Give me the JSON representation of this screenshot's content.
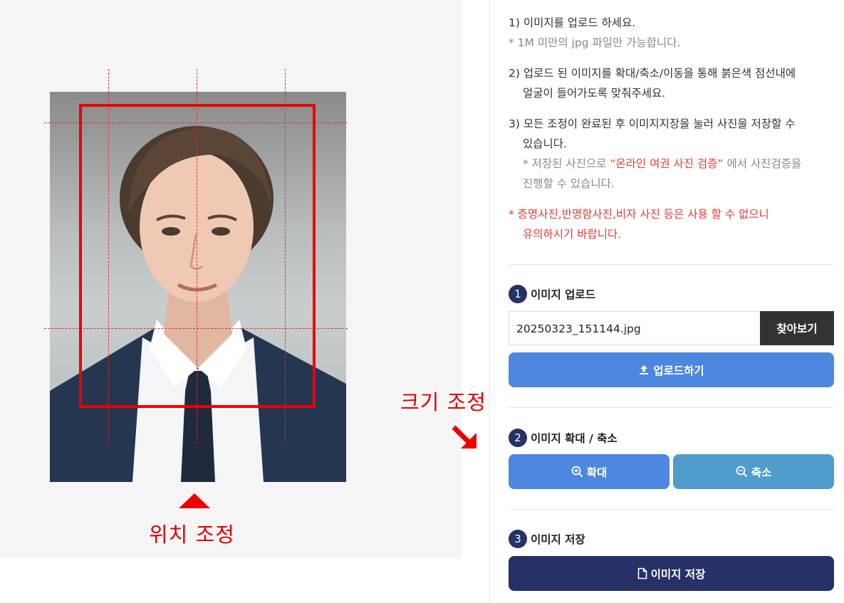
{
  "editor": {
    "position_label": "위치 조정",
    "size_label": "크기 조정"
  },
  "instructions": {
    "step1": "1) 이미지를 업로드 하세요.",
    "step1_note": "* 1M 미만의 jpg 파일만 가능합니다.",
    "step2_line1": "2) 업로드 된 이미지를 확대/축소/이동을 통해 붉은색 점선내에",
    "step2_line2": "얼굴이 들어가도록 맞춰주세요.",
    "step3_line1": "3) 모든 조정이 완료된 후 이미지지장을 눌러 사진을 저장할 수",
    "step3_line2": "있습니다.",
    "step3_note_prefix": "* 저장된 사진으로 ",
    "step3_note_highlight": "“온라인 여권 사진 검증”",
    "step3_note_suffix": " 에서 사진검증을",
    "step3_note_line2": "진행할 수 있습니다.",
    "warning_line1": "* 증명사진,반명함사진,비자 사진 등은 사용 할 수 없으니",
    "warning_line2": "유의하시기 바랍니다."
  },
  "upload_section": {
    "number": "1",
    "title": "이미지 업로드",
    "file_name": "20250323_151144.jpg",
    "browse_label": "찾아보기",
    "upload_label": "업로드하기",
    "upload_icon": "upload-icon"
  },
  "zoom_section": {
    "number": "2",
    "title": "이미지 확대 / 축소",
    "zoom_in_label": "확대",
    "zoom_out_label": "축소",
    "zoom_in_icon": "zoom-in-icon",
    "zoom_out_icon": "zoom-out-icon"
  },
  "save_section": {
    "number": "3",
    "title": "이미지 저장",
    "save_label": "이미지 저장",
    "save_icon": "file-icon"
  },
  "colors": {
    "guide_red": "#ee0000",
    "navy": "#253167",
    "primary_blue": "#4d87e0",
    "secondary_blue": "#4f9ccd",
    "dark_button": "#333333"
  }
}
